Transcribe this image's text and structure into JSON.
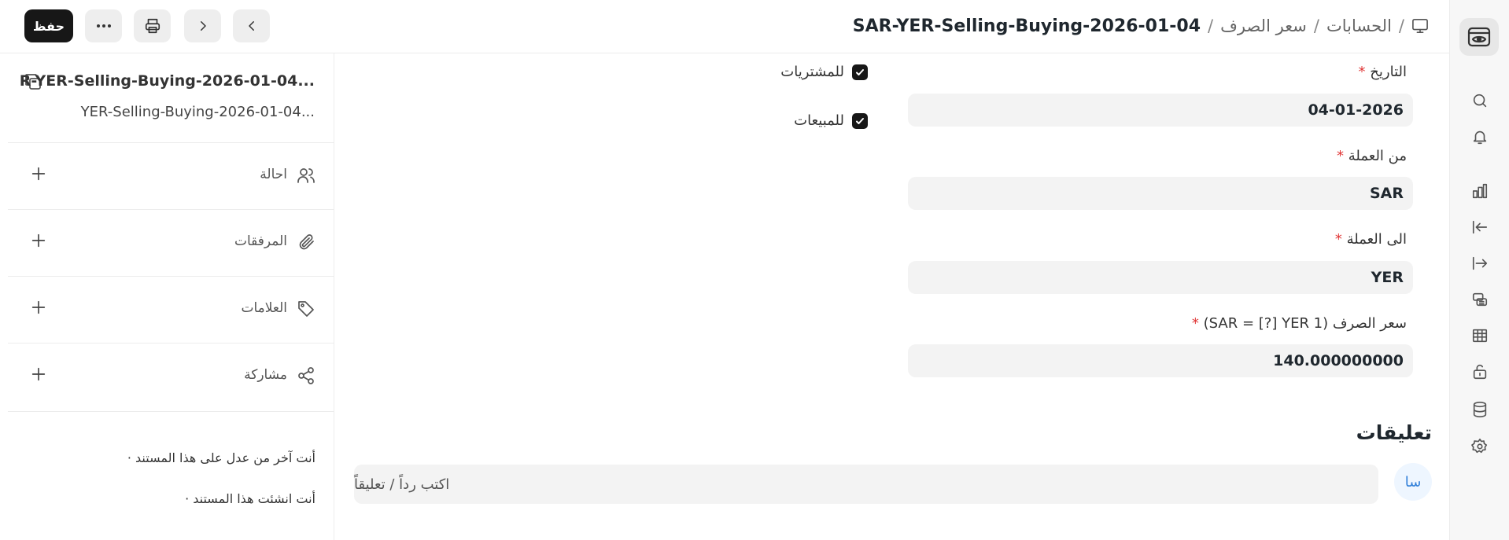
{
  "toolbar": {
    "save_label": "حفظ",
    "breadcrumb": {
      "level1": "الحسابات",
      "level2": "سعر الصرف",
      "current": "SAR-YER-Selling-Buying-2026-01-04",
      "separator": "/"
    }
  },
  "sidebar": {
    "doc_title": "R-YER-Selling-Buying-2026-01-04...",
    "doc_subtitle": "YER-Selling-Buying-2026-01-04...",
    "sections": [
      {
        "label": "احالة",
        "icon": "users-icon"
      },
      {
        "label": "المرفقات",
        "icon": "paperclip-icon"
      },
      {
        "label": "العلامات",
        "icon": "tag-icon"
      },
      {
        "label": "مشاركة",
        "icon": "share-icon"
      }
    ],
    "activity": [
      "أنت آخر من عدل على هذا المستند ·",
      "أنت انشئت هذا المستند ·"
    ]
  },
  "form": {
    "date_label": "التاريخ",
    "date_value": "04-01-2026",
    "from_currency_label": "من العملة",
    "from_currency_value": "SAR",
    "to_currency_label": "الى العملة",
    "to_currency_value": "YER",
    "rate_label": "سعر الصرف (SAR = [?] YER 1)",
    "rate_value": "140.000000000",
    "required_mark": "*",
    "for_buying_label": "للمشتريات",
    "for_buying_checked": true,
    "for_selling_label": "للمبيعات",
    "for_selling_checked": true
  },
  "comments": {
    "title": "تعليقات",
    "avatar_initials": "سا",
    "placeholder": "اكتب رداً / تعليقاً"
  },
  "colors": {
    "primary_button": "#171717",
    "required": "#e03636",
    "input_bg": "#f3f3f3",
    "avatar_text": "#2f7ed8"
  }
}
